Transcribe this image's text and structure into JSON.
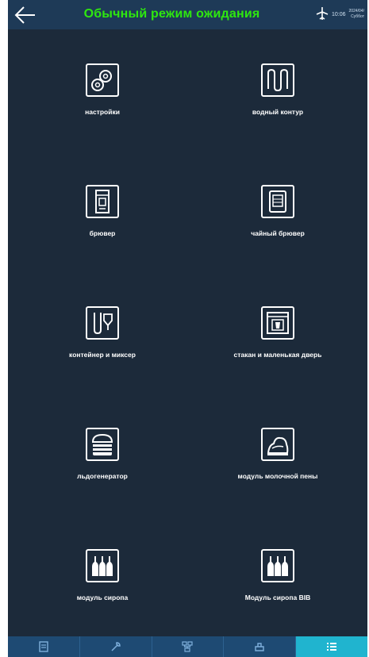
{
  "header": {
    "title": "Обычный режим ожидания",
    "time": "10:06",
    "date_line1": "2024/04/",
    "date_line2": "Суббот"
  },
  "menu": {
    "items": [
      {
        "label": "настройки",
        "icon": "gears-icon"
      },
      {
        "label": "водный контур",
        "icon": "water-circuit-icon"
      },
      {
        "label": "брювер",
        "icon": "brewer-icon"
      },
      {
        "label": "чайный брювер",
        "icon": "tea-brewer-icon"
      },
      {
        "label": "контейнер и миксер",
        "icon": "container-mixer-icon"
      },
      {
        "label": "стакан и маленькая дверь",
        "icon": "cup-door-icon"
      },
      {
        "label": "льдогенератор",
        "icon": "ice-maker-icon"
      },
      {
        "label": "модуль молочной пены",
        "icon": "milk-foam-icon"
      },
      {
        "label": "модуль сиропа",
        "icon": "syrup-module-icon"
      },
      {
        "label": "Модуль сиропа BIB",
        "icon": "syrup-bib-icon"
      }
    ]
  },
  "bottom_nav": {
    "tabs": [
      {
        "icon": "document-icon",
        "active": false
      },
      {
        "icon": "tools-icon",
        "active": false
      },
      {
        "icon": "network-icon",
        "active": false
      },
      {
        "icon": "dispenser-icon",
        "active": false
      },
      {
        "icon": "list-icon",
        "active": true
      }
    ],
    "active_color": "#20b4cf"
  },
  "colors": {
    "background": "#1c2a3a",
    "header_bg": "#1e3a57",
    "title": "#2ee80f",
    "nav_bg": "#1e4a73"
  }
}
